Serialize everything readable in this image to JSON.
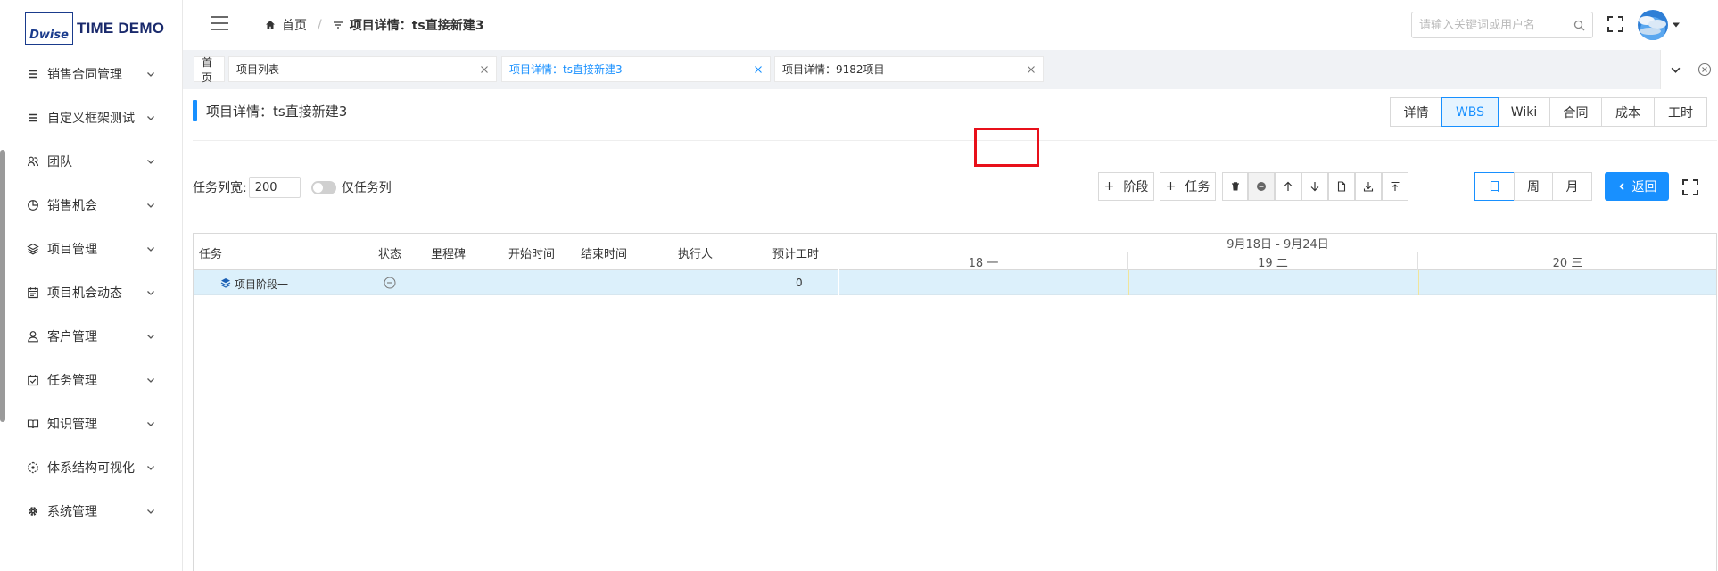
{
  "app": {
    "logo_mark": "Dwise",
    "logo_text": "TIME DEMO"
  },
  "sidebar": {
    "items": [
      {
        "label": "销售合同管理",
        "icon": "list-icon"
      },
      {
        "label": "自定义框架测试",
        "icon": "list-icon"
      },
      {
        "label": "团队",
        "icon": "team-icon"
      },
      {
        "label": "销售机会",
        "icon": "pie-chart-icon"
      },
      {
        "label": "项目管理",
        "icon": "layers-icon"
      },
      {
        "label": "项目机会动态",
        "icon": "calendar-icon"
      },
      {
        "label": "客户管理",
        "icon": "user-icon"
      },
      {
        "label": "任务管理",
        "icon": "checkbox-calendar-icon"
      },
      {
        "label": "知识管理",
        "icon": "book-icon"
      },
      {
        "label": "体系结构可视化",
        "icon": "network-icon"
      },
      {
        "label": "系统管理",
        "icon": "gear-icon"
      }
    ]
  },
  "header": {
    "breadcrumb_home": "首页",
    "breadcrumb_current": "项目详情：ts直接新建3",
    "search_placeholder": "请输入关键词或用户名"
  },
  "tabs": [
    {
      "label": "首页"
    },
    {
      "label": "项目列表"
    },
    {
      "label": "项目详情：ts直接新建3",
      "active": true
    },
    {
      "label": "项目详情：9182项目"
    }
  ],
  "page": {
    "title": "项目详情：ts直接新建3",
    "view_tabs": [
      "详情",
      "WBS",
      "Wiki",
      "合同",
      "成本",
      "工时"
    ],
    "active_view": "WBS"
  },
  "toolbar": {
    "task_width_label": "任务列宽:",
    "task_width_value": "200",
    "only_task_label": "仅任务列",
    "add_stage": "阶段",
    "add_task": "任务",
    "scale_day": "日",
    "scale_week": "周",
    "scale_month": "月",
    "back": "返回"
  },
  "gantt": {
    "columns": [
      "任务",
      "状态",
      "里程碑",
      "开始时间",
      "结束时间",
      "执行人",
      "预计工时"
    ],
    "rows": [
      {
        "task": "项目阶段一",
        "status_icon": "minus-circle-icon",
        "milestone": "",
        "start": "",
        "end": "",
        "assignee": "",
        "hours": "0"
      }
    ],
    "week_label": "9月18日 - 9月24日",
    "days": [
      "18 一",
      "19 二",
      "20 三"
    ]
  },
  "colors": {
    "accent": "#1890ff",
    "highlight": "#e8101a",
    "row_selected": "#dcf0fb"
  }
}
